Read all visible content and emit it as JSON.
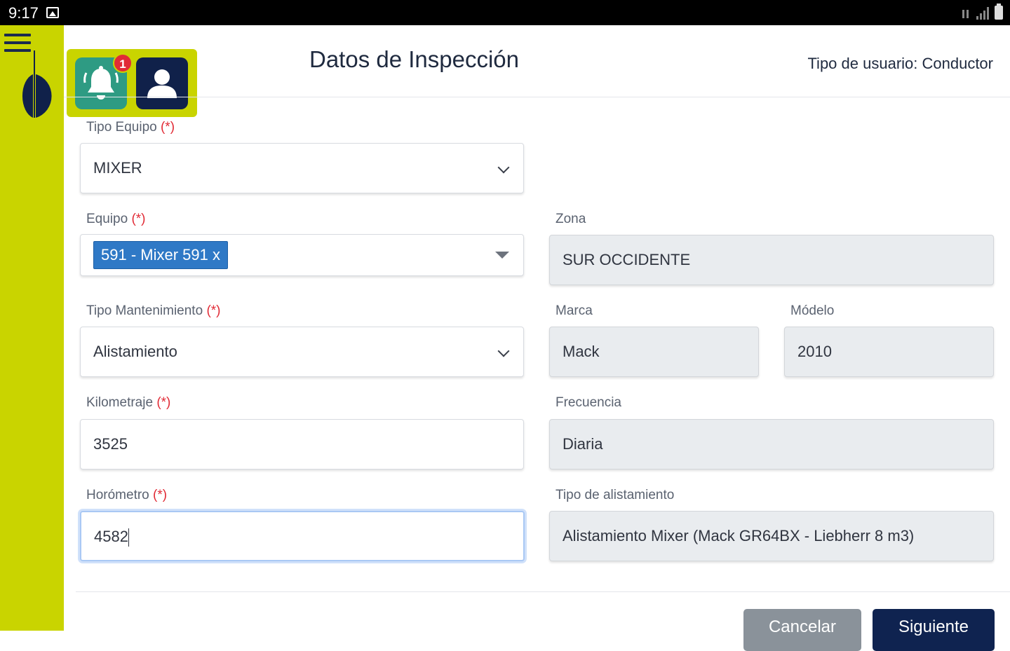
{
  "status_bar": {
    "time": "9:17"
  },
  "header": {
    "title": "Datos de Inspección",
    "user_type": "Tipo de usuario: Conductor",
    "notification_count": "1"
  },
  "form": {
    "tipo_equipo": {
      "label": "Tipo Equipo",
      "required_mark": "(*)",
      "value": "MIXER"
    },
    "equipo": {
      "label": "Equipo",
      "required_mark": "(*)",
      "tag": "591 - Mixer 591 x"
    },
    "zona": {
      "label": "Zona",
      "value": "SUR OCCIDENTE"
    },
    "tipo_mantenimiento": {
      "label": "Tipo Mantenimiento",
      "required_mark": "(*)",
      "value": "Alistamiento"
    },
    "marca": {
      "label": "Marca",
      "value": "Mack"
    },
    "modelo": {
      "label": "Módelo",
      "value": "2010"
    },
    "kilometraje": {
      "label": "Kilometraje",
      "required_mark": "(*)",
      "value": "3525"
    },
    "frecuencia": {
      "label": "Frecuencia",
      "value": "Diaria"
    },
    "horometro": {
      "label": "Horómetro",
      "required_mark": "(*)",
      "value": "4582"
    },
    "tipo_alistamiento": {
      "label": "Tipo de alistamiento",
      "value": "Alistamiento Mixer (Mack GR64BX - Liebherr 8 m3)"
    }
  },
  "actions": {
    "cancel_label": "Cancelar",
    "next_label": "Siguiente"
  },
  "colors": {
    "sidebar": "#c9d400",
    "primary": "#0f2350",
    "notification": "#2e9b83",
    "badge": "#e12b36",
    "tag": "#2f79c6"
  },
  "icons": [
    "hamburger-icon",
    "bell-icon",
    "user-icon",
    "chevron-down-icon",
    "caret-down-icon"
  ]
}
